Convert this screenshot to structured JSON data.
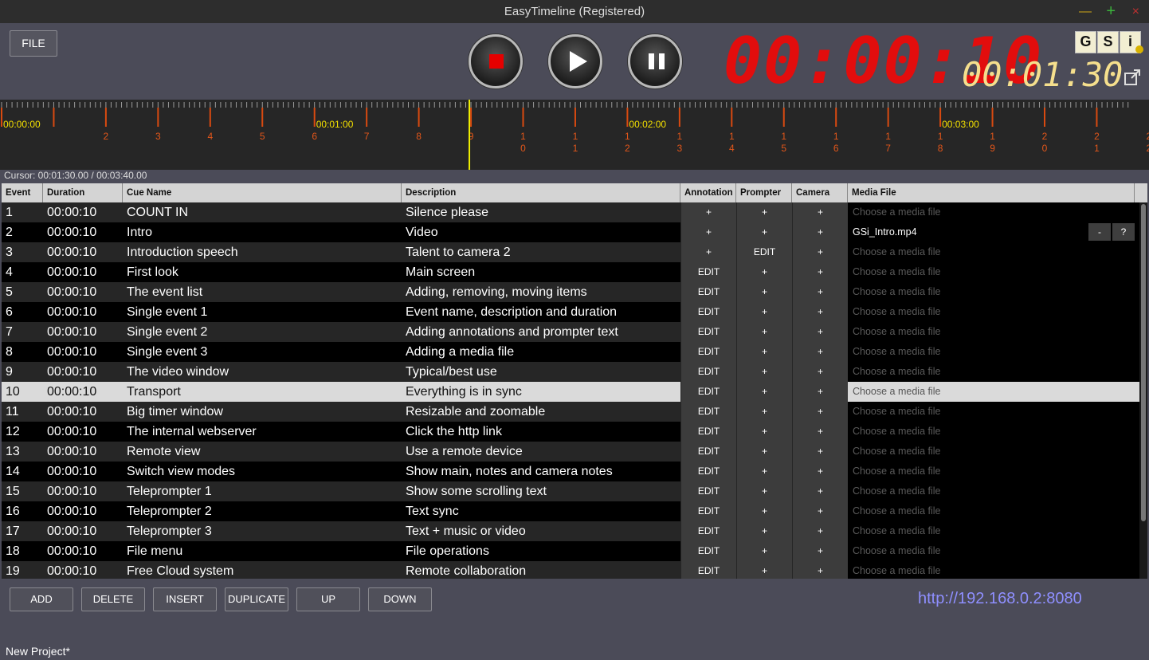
{
  "window": {
    "title": "EasyTimeline (Registered)",
    "minimize": "—",
    "maximize": "+",
    "close": "×"
  },
  "toolbar": {
    "file_label": "FILE"
  },
  "clock": {
    "big": "00:00:10",
    "small": "00:01:30"
  },
  "logo": {
    "g": "G",
    "s": "S",
    "i": "i"
  },
  "ruler": {
    "major_labels": [
      "00:00:00",
      "00:01:00",
      "00:02:00",
      "00:03:00"
    ],
    "minor_labels": [
      "2",
      "3",
      "4",
      "5",
      "6",
      "7",
      "8",
      "9",
      "10",
      "11",
      "12",
      "13",
      "14",
      "15",
      "16",
      "17",
      "18",
      "19",
      "20",
      "21",
      "22"
    ],
    "playhead_seconds": 90
  },
  "cursor_text": "Cursor: 00:01:30.00 / 00:03:40.00",
  "table": {
    "headers": [
      "Event",
      "Duration",
      "Cue Name",
      "Description",
      "Annotation",
      "Prompter",
      "Camera",
      "Media File"
    ],
    "media_placeholder": "Choose a media file",
    "rows": [
      {
        "event": "1",
        "duration": "00:00:10",
        "cue": "COUNT IN",
        "desc": "Silence please",
        "annotation": "+",
        "prompter": "+",
        "camera": "+",
        "media": ""
      },
      {
        "event": "2",
        "duration": "00:00:10",
        "cue": "Intro",
        "desc": "Video",
        "annotation": "+",
        "prompter": "+",
        "camera": "+",
        "media": "GSi_Intro.mp4"
      },
      {
        "event": "3",
        "duration": "00:00:10",
        "cue": "Introduction speech",
        "desc": "Talent to camera 2",
        "annotation": "+",
        "prompter": "EDIT",
        "camera": "+",
        "media": ""
      },
      {
        "event": "4",
        "duration": "00:00:10",
        "cue": "First look",
        "desc": "Main screen",
        "annotation": "EDIT",
        "prompter": "+",
        "camera": "+",
        "media": ""
      },
      {
        "event": "5",
        "duration": "00:00:10",
        "cue": "The event list",
        "desc": "Adding, removing, moving items",
        "annotation": "EDIT",
        "prompter": "+",
        "camera": "+",
        "media": ""
      },
      {
        "event": "6",
        "duration": "00:00:10",
        "cue": "Single event 1",
        "desc": "Event name, description and duration",
        "annotation": "EDIT",
        "prompter": "+",
        "camera": "+",
        "media": ""
      },
      {
        "event": "7",
        "duration": "00:00:10",
        "cue": "Single event 2",
        "desc": "Adding annotations and prompter text",
        "annotation": "EDIT",
        "prompter": "+",
        "camera": "+",
        "media": ""
      },
      {
        "event": "8",
        "duration": "00:00:10",
        "cue": "Single event 3",
        "desc": "Adding a media file",
        "annotation": "EDIT",
        "prompter": "+",
        "camera": "+",
        "media": ""
      },
      {
        "event": "9",
        "duration": "00:00:10",
        "cue": "The video window",
        "desc": "Typical/best use",
        "annotation": "EDIT",
        "prompter": "+",
        "camera": "+",
        "media": ""
      },
      {
        "event": "10",
        "duration": "00:00:10",
        "cue": "Transport",
        "desc": "Everything is in sync",
        "annotation": "EDIT",
        "prompter": "+",
        "camera": "+",
        "media": ""
      },
      {
        "event": "11",
        "duration": "00:00:10",
        "cue": "Big timer window",
        "desc": "Resizable and zoomable",
        "annotation": "EDIT",
        "prompter": "+",
        "camera": "+",
        "media": ""
      },
      {
        "event": "12",
        "duration": "00:00:10",
        "cue": "The internal webserver",
        "desc": "Click the http link",
        "annotation": "EDIT",
        "prompter": "+",
        "camera": "+",
        "media": ""
      },
      {
        "event": "13",
        "duration": "00:00:10",
        "cue": "Remote view",
        "desc": "Use a remote device",
        "annotation": "EDIT",
        "prompter": "+",
        "camera": "+",
        "media": ""
      },
      {
        "event": "14",
        "duration": "00:00:10",
        "cue": "Switch view modes",
        "desc": "Show main, notes and camera notes",
        "annotation": "EDIT",
        "prompter": "+",
        "camera": "+",
        "media": ""
      },
      {
        "event": "15",
        "duration": "00:00:10",
        "cue": "Teleprompter 1",
        "desc": "Show some scrolling text",
        "annotation": "EDIT",
        "prompter": "+",
        "camera": "+",
        "media": ""
      },
      {
        "event": "16",
        "duration": "00:00:10",
        "cue": "Teleprompter 2",
        "desc": "Text sync",
        "annotation": "EDIT",
        "prompter": "+",
        "camera": "+",
        "media": ""
      },
      {
        "event": "17",
        "duration": "00:00:10",
        "cue": "Teleprompter 3",
        "desc": "Text + music or video",
        "annotation": "EDIT",
        "prompter": "+",
        "camera": "+",
        "media": ""
      },
      {
        "event": "18",
        "duration": "00:00:10",
        "cue": "File menu",
        "desc": "File operations",
        "annotation": "EDIT",
        "prompter": "+",
        "camera": "+",
        "media": ""
      },
      {
        "event": "19",
        "duration": "00:00:10",
        "cue": "Free Cloud system",
        "desc": "Remote collaboration",
        "annotation": "EDIT",
        "prompter": "+",
        "camera": "+",
        "media": ""
      }
    ],
    "selected_event": "10",
    "media_buttons": {
      "remove": "-",
      "help": "?"
    }
  },
  "bottom": {
    "buttons": [
      "ADD",
      "DELETE",
      "INSERT",
      "DUPLICATE",
      "UP",
      "DOWN"
    ],
    "url": "http://192.168.0.2:8080",
    "status": "New Project*"
  },
  "colors": {
    "accent_red": "#e20d0d",
    "small_clock": "#f5df8d",
    "url": "#8f8fff",
    "playhead": "#f0f000"
  },
  "icons": [
    "stop-icon",
    "play-icon",
    "pause-icon",
    "popout-icon"
  ]
}
